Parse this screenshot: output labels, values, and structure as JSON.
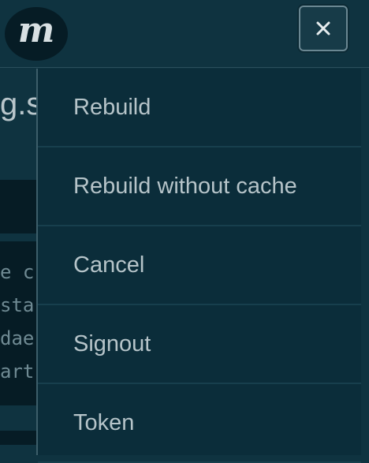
{
  "header": {
    "logo_letter": "m",
    "close_icon": "close-icon"
  },
  "background": {
    "title_fragment": "g.su",
    "code_lines": [
      "e c",
      "sta",
      "dae",
      "art"
    ]
  },
  "menu": {
    "items": [
      {
        "label": "Rebuild"
      },
      {
        "label": "Rebuild without cache"
      },
      {
        "label": "Cancel"
      },
      {
        "label": "Signout"
      },
      {
        "label": "Token"
      }
    ]
  },
  "colors": {
    "background": "#0f3340",
    "menu_background": "#0b2d3a",
    "text": "#b6c4c9"
  }
}
